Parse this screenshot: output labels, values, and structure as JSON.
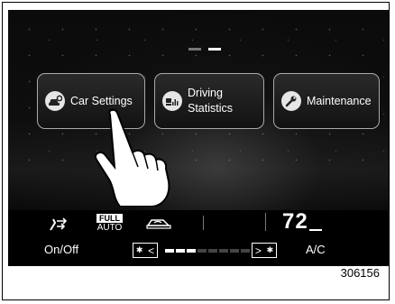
{
  "home_menu": {
    "page_indicator": {
      "pages": 2,
      "active_index": 1
    },
    "items": [
      {
        "label": "Car Settings",
        "icon": "car-settings-icon"
      },
      {
        "label_line1": "Driving",
        "label_line2": "Statistics",
        "icon": "driving-statistics-icon"
      },
      {
        "label": "Maintenance",
        "icon": "wrench-icon"
      }
    ]
  },
  "climate": {
    "full_label": "FULL",
    "auto_label": "AUTO",
    "onoff_label": "On/Off",
    "temperature": "72",
    "ac_label": "A/C",
    "fan_level": 3,
    "fan_max": 8
  },
  "figure_code": "306156"
}
